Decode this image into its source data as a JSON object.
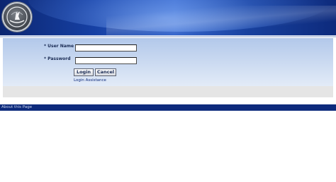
{
  "login": {
    "username_label": "User Name",
    "password_label": "Password",
    "required_marker": "*",
    "username_value": "",
    "password_value": "",
    "login_button": "Login",
    "cancel_button": "Cancel",
    "assistance_link": "Login Assistance"
  },
  "footer": {
    "about_link": "About this Page"
  },
  "icons": {
    "logo": "emblem-logo-icon"
  },
  "colors": {
    "header_dark": "#0c2670",
    "header_light": "#3566cc",
    "panel_top": "#b2c8ea",
    "panel_bottom": "#eef3fb",
    "bottom_bar": "#0d2a7c",
    "label_text": "#1b2c55"
  }
}
